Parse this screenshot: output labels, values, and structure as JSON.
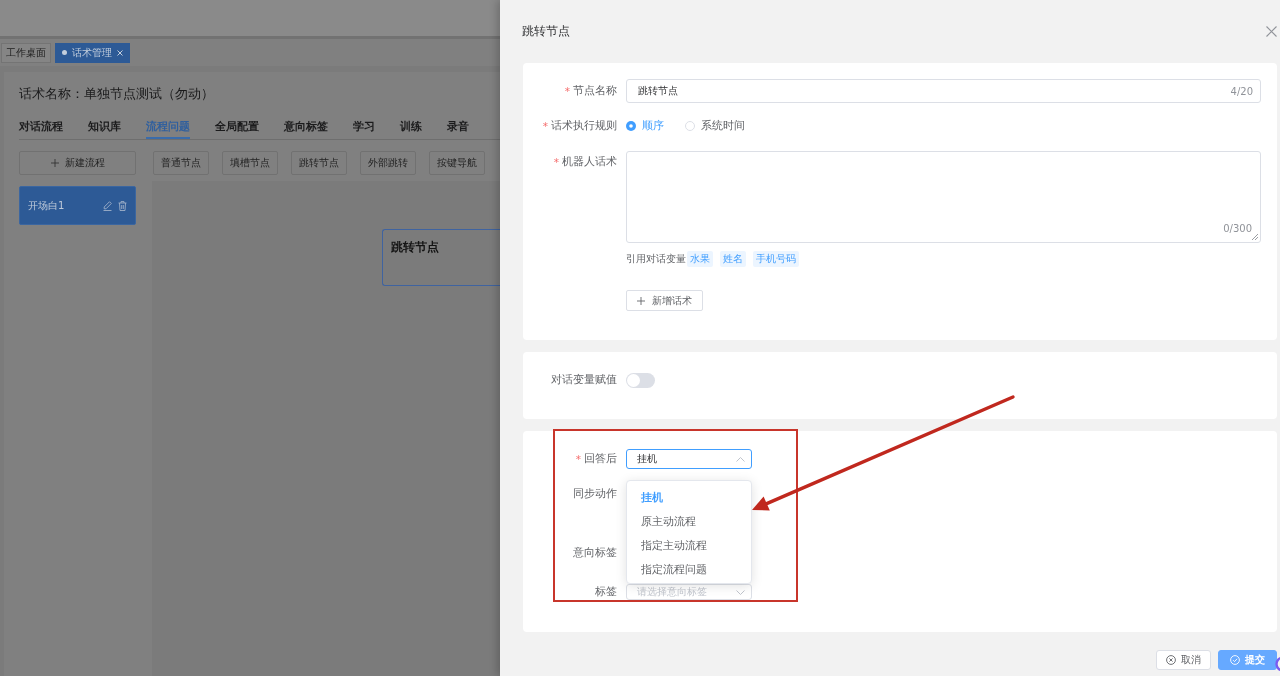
{
  "background": {
    "page_tabs": [
      {
        "label": "工作桌面",
        "selected": false,
        "closable": false
      },
      {
        "label": "话术管理",
        "selected": true,
        "closable": true
      }
    ],
    "script_title": "话术名称：单独节点测试（勿动）",
    "tabs": [
      {
        "label": "对话流程",
        "selected": false
      },
      {
        "label": "知识库",
        "selected": false
      },
      {
        "label": "流程问题",
        "selected": true
      },
      {
        "label": "全局配置",
        "selected": false
      },
      {
        "label": "意向标签",
        "selected": false
      },
      {
        "label": "学习",
        "selected": false
      },
      {
        "label": "训练",
        "selected": false
      },
      {
        "label": "录音",
        "selected": false
      }
    ],
    "new_flow_button": "新建流程",
    "node_types": [
      "普通节点",
      "填槽节点",
      "跳转节点",
      "外部跳转",
      "按键导航"
    ],
    "flows": [
      {
        "label": "开场白1",
        "selected": true
      }
    ],
    "canvas_nodes": [
      {
        "label": "跳转节点",
        "selected": true
      }
    ]
  },
  "drawer": {
    "title": "跳转节点",
    "node_name": {
      "required_mark": "*",
      "label": "节点名称",
      "value": "跳转节点",
      "counter": "4/20"
    },
    "rule": {
      "required_mark": "*",
      "label": "话术执行规则",
      "options": [
        {
          "label": "顺序",
          "selected": true
        },
        {
          "label": "系统时间",
          "selected": false
        }
      ]
    },
    "robot_script": {
      "required_mark": "*",
      "label": "机器人话术",
      "counter": "0/300"
    },
    "variables": {
      "label": "引用对话变量",
      "tags": [
        "水果",
        "姓名",
        "手机号码"
      ]
    },
    "add_script_button": "新增话术",
    "variable_assignment": {
      "label": "对话变量赋值",
      "on": false
    },
    "after_answer": {
      "required_mark": "*",
      "label": "回答后",
      "value": "挂机",
      "expanded": true,
      "options": [
        {
          "label": "挂机",
          "selected": true
        },
        {
          "label": "原主动流程",
          "selected": false
        },
        {
          "label": "指定主动流程",
          "selected": false
        },
        {
          "label": "指定流程问题",
          "selected": false
        }
      ]
    },
    "sync_action": {
      "label": "同步动作"
    },
    "intent_tag": {
      "label": "意向标签"
    },
    "tag": {
      "label": "标签",
      "placeholder": "请选择意向标签"
    },
    "buttons": [
      {
        "label": "取消",
        "kind": "cancel"
      },
      {
        "label": "提交",
        "kind": "submit"
      }
    ]
  }
}
